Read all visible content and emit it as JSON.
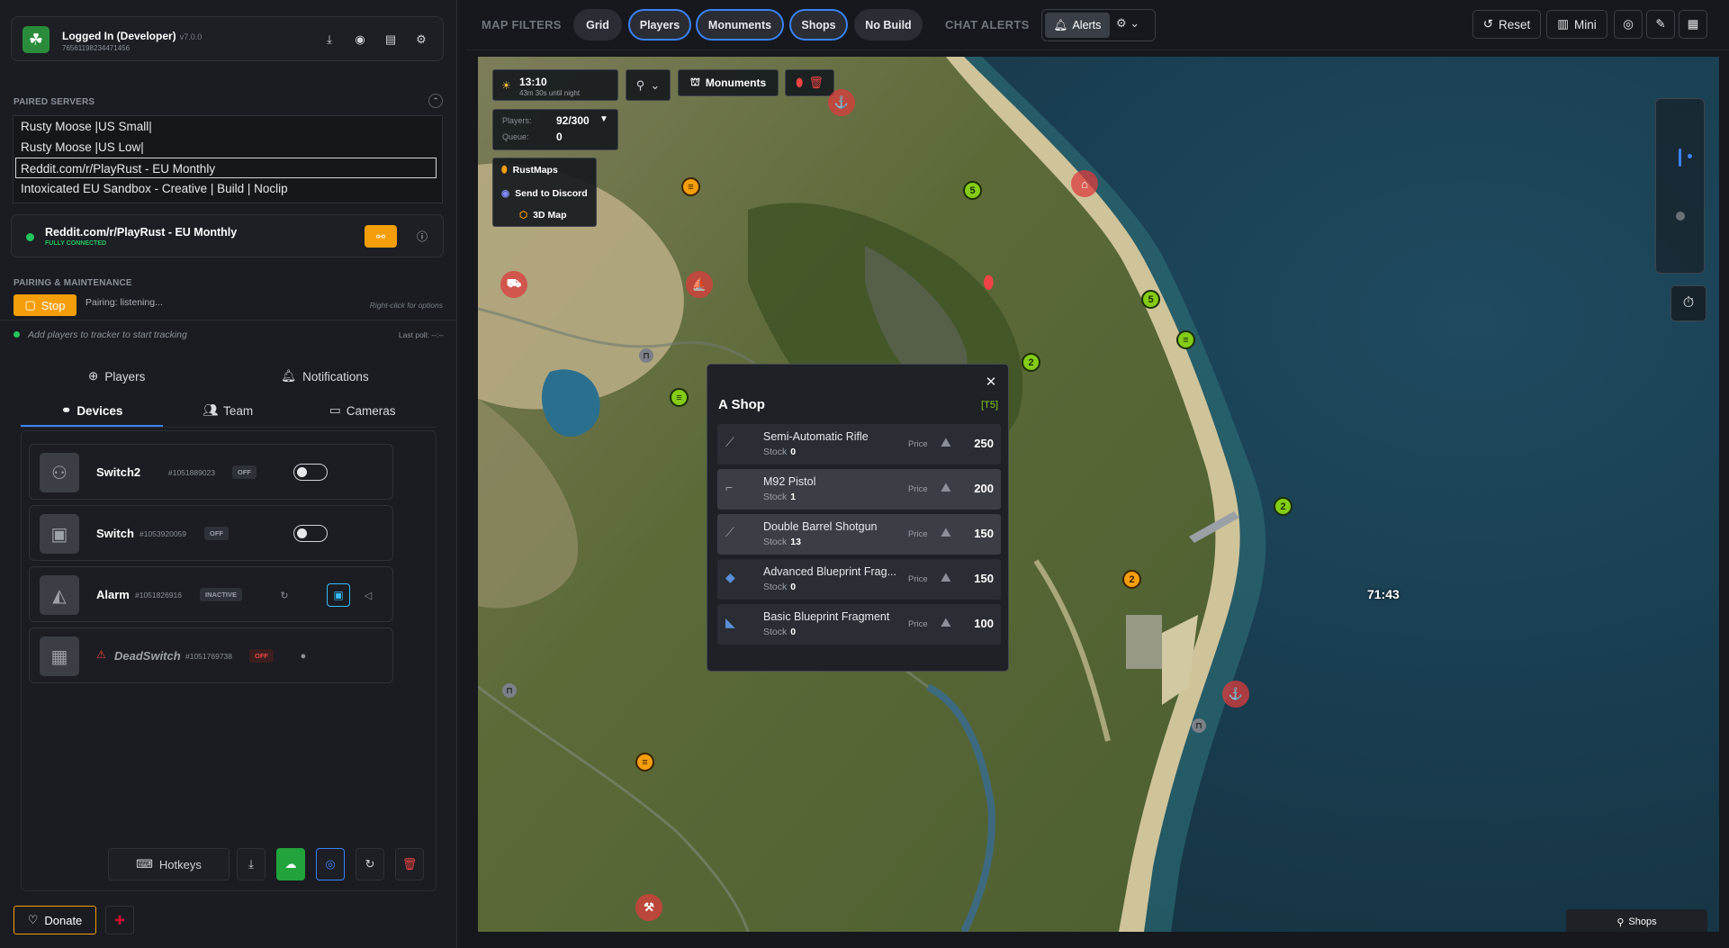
{
  "user": {
    "title": "Logged In (Developer)",
    "version": "v7.0.0",
    "steam_id": "76561198234471456"
  },
  "paired_servers": {
    "label": "PAIRED SERVERS",
    "items": [
      "Rusty Moose |US Small|",
      "Rusty Moose |US Low|",
      "Reddit.com/r/PlayRust - EU Monthly",
      "Intoxicated EU Sandbox - Creative | Build | Noclip"
    ]
  },
  "connection": {
    "server_name": "Reddit.com/r/PlayRust - EU Monthly",
    "status": "FULLY CONNECTED"
  },
  "maintenance": {
    "label": "PAIRING & MAINTENANCE",
    "stop_label": "Stop",
    "pairing_status": "Pairing: listening...",
    "right_click_hint": "Right-click for options",
    "tracker_hint": "Add players to tracker to start tracking",
    "last_poll": "Last poll: --:--"
  },
  "tabs": {
    "players": "Players",
    "notifications": "Notifications",
    "devices": "Devices",
    "team": "Team",
    "cameras": "Cameras"
  },
  "devices": [
    {
      "name": "Switch2",
      "id": "#1051889023",
      "status": "OFF"
    },
    {
      "name": "Switch",
      "id": "#1053920059",
      "status": "OFF"
    },
    {
      "name": "Alarm",
      "id": "#1051826916",
      "status": "INACTIVE"
    },
    {
      "name": "DeadSwitch",
      "id": "#1051769738",
      "status": "OFF"
    }
  ],
  "bottom": {
    "hotkeys": "Hotkeys",
    "donate": "Donate"
  },
  "topbar": {
    "map_filters": "MAP FILTERS",
    "grid": "Grid",
    "players": "Players",
    "monuments": "Monuments",
    "shops": "Shops",
    "no_build": "No Build",
    "chat_alerts": "CHAT ALERTS",
    "alerts": "Alerts",
    "reset": "Reset",
    "mini": "Mini"
  },
  "map": {
    "time": "13:10",
    "time_sub": "43m 30s until night",
    "players_label": "Players:",
    "players_value": "92/300",
    "queue_label": "Queue:",
    "queue_value": "0",
    "monuments_btn": "Monuments",
    "rustmaps": "RustMaps",
    "send_discord": "Send to Discord",
    "map3d": "3D Map",
    "ship_timer": "71:43",
    "shops_tab": "Shops",
    "colors": {
      "land": "#5e6b3a",
      "sea": "#1b4358",
      "beach": "#c9bf95"
    }
  },
  "shop": {
    "title": "A Shop",
    "grid": "[T5]",
    "price_label": "Price",
    "stock_label": "Stock",
    "items": [
      {
        "name": "Semi-Automatic Rifle",
        "stock": "0",
        "price": "250"
      },
      {
        "name": "M92 Pistol",
        "stock": "1",
        "price": "200"
      },
      {
        "name": "Double Barrel Shotgun",
        "stock": "13",
        "price": "150"
      },
      {
        "name": "Advanced Blueprint Frag...",
        "stock": "0",
        "price": "150"
      },
      {
        "name": "Basic Blueprint Fragment",
        "stock": "0",
        "price": "100"
      }
    ]
  }
}
